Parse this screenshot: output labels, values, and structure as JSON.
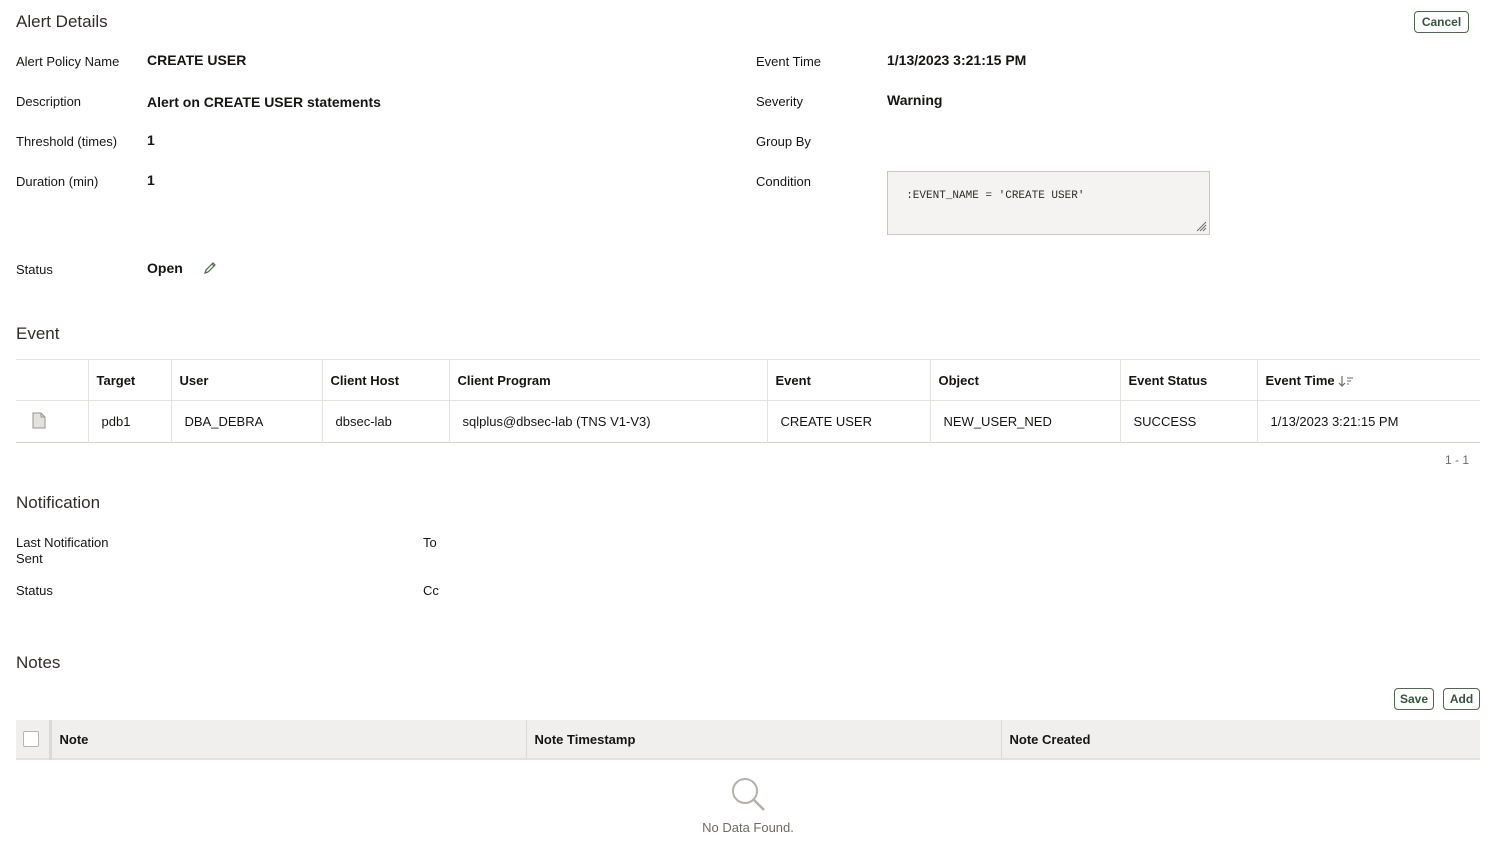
{
  "alert_details": {
    "title": "Alert Details",
    "cancel_label": "Cancel",
    "left_fields": [
      {
        "label": "Alert Policy Name",
        "value": "CREATE USER"
      },
      {
        "label": "Description",
        "value": "Alert on CREATE USER statements"
      },
      {
        "label": "Threshold (times)",
        "value": "1"
      },
      {
        "label": "Duration (min)",
        "value": "1"
      },
      {
        "label": "Status",
        "value": "Open"
      }
    ],
    "right_fields": [
      {
        "label": "Event Time",
        "value": "1/13/2023 3:21:15 PM"
      },
      {
        "label": "Severity",
        "value": "Warning"
      },
      {
        "label": "Group By",
        "value": ""
      },
      {
        "label": "Condition",
        "value": ":EVENT_NAME = 'CREATE USER'"
      }
    ]
  },
  "event": {
    "title": "Event",
    "columns": [
      "",
      "Target",
      "User",
      "Client Host",
      "Client Program",
      "Event",
      "Object",
      "Event Status",
      "Event Time"
    ],
    "rows": [
      [
        "",
        "pdb1",
        "DBA_DEBRA",
        "dbsec-lab",
        "sqlplus@dbsec-lab (TNS V1-V3)",
        "CREATE USER",
        "NEW_USER_NED",
        "SUCCESS",
        "1/13/2023 3:21:15 PM"
      ]
    ],
    "pagination": "1 - 1"
  },
  "notification": {
    "title": "Notification",
    "last_sent_label": "Last Notification Sent",
    "status_label": "Status",
    "to_label": "To",
    "cc_label": "Cc"
  },
  "notes": {
    "title": "Notes",
    "save_label": "Save",
    "add_label": "Add",
    "columns": [
      "Note",
      "Note Timestamp",
      "Note Created"
    ],
    "empty_text": "No Data Found."
  },
  "colors": {
    "accent_green": "#33553c",
    "header_bg": "#f1efed"
  }
}
